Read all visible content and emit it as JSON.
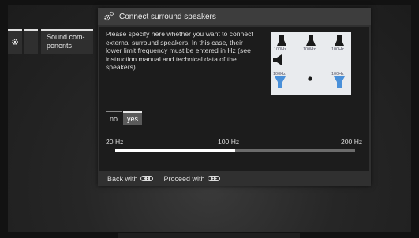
{
  "breadcrumb": {
    "items": [
      {
        "icon": "gear-icon",
        "label": ""
      },
      {
        "label": "..."
      },
      {
        "label": "Sound com-\nponents"
      }
    ]
  },
  "dialog": {
    "title": "Connect surround speakers",
    "title_icon": "gears-icon",
    "description": "Please specify here whether you want to connect external surround speakers. In this case, their lower limit frequency must be entered in Hz (see instruction manual and technical data of the speakers).",
    "diagram": {
      "labels": [
        "100Hz",
        "100Hz",
        "100Hz",
        "100Hz",
        "100Hz"
      ]
    },
    "toggle": {
      "options": [
        "no",
        "yes"
      ],
      "selected": "yes"
    },
    "slider": {
      "min_label": "20 Hz",
      "mid_label": "100 Hz",
      "max_label": "200 Hz",
      "value_fraction": 0.5
    },
    "footer": {
      "back_label": "Back with",
      "back_icon": "rewind-key-icon",
      "proceed_label": "Proceed with",
      "proceed_icon": "forward-key-icon"
    }
  },
  "colors": {
    "background": "#121212",
    "dialog_body": "#1c1c1c",
    "header": "#3d3d3d",
    "subwoofer_accent": "#4a90d9"
  }
}
